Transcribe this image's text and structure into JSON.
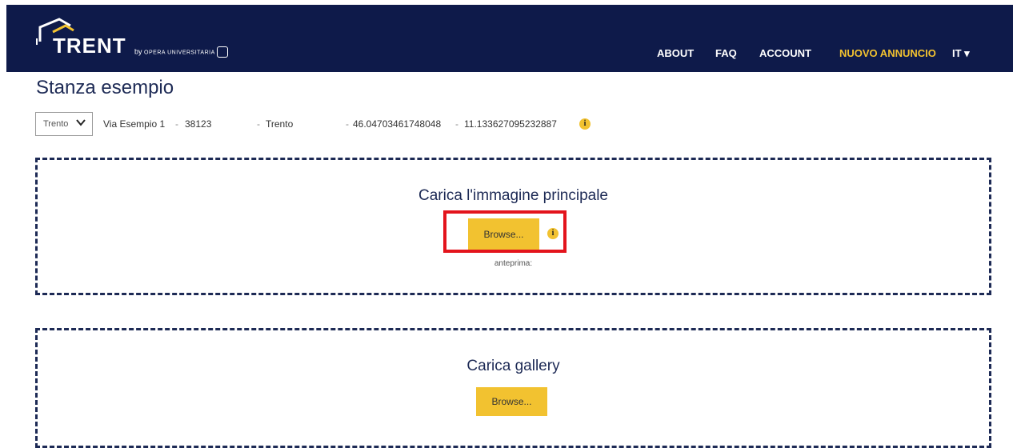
{
  "brand": {
    "logo_text": "TRENT",
    "by_prefix": "by",
    "by_org": "OPERA UNIVERSITARIA"
  },
  "nav": {
    "about": "ABOUT",
    "faq": "FAQ",
    "account": "ACCOUNT",
    "new_listing": "NUOVO ANNUNCIO",
    "language": "IT ▾"
  },
  "page": {
    "title": "Stanza esempio"
  },
  "address": {
    "city_select_value": "Trento",
    "street": "Via Esempio 1",
    "postal_code": "38123",
    "city": "Trento",
    "latitude": "46.04703461748048",
    "longitude": "11.133627095232887",
    "separator": "-"
  },
  "main_image": {
    "heading": "Carica l'immagine principale",
    "browse_label": "Browse...",
    "preview_label": "anteprima:"
  },
  "gallery": {
    "heading": "Carica gallery",
    "browse_label": "Browse..."
  },
  "colors": {
    "navbar": "#0e1a4a",
    "accent": "#f2c230",
    "highlight": "#e3141c"
  }
}
